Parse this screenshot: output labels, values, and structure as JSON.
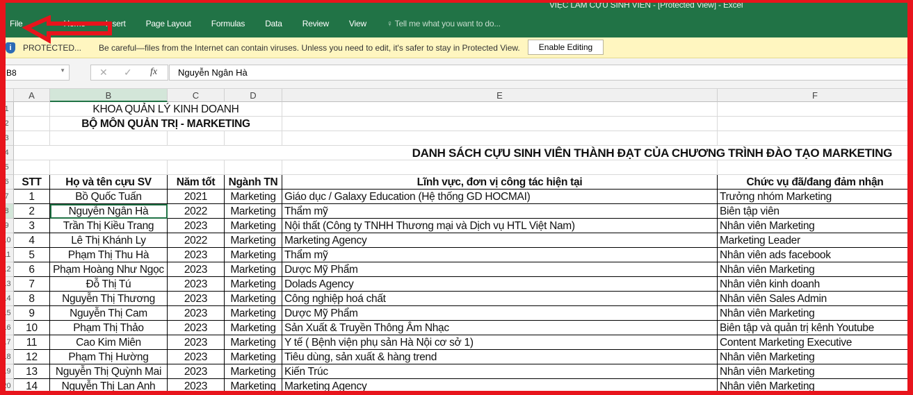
{
  "window": {
    "title": "VIỆC LÀM CỰU SINH VIÊN - [Protected View] - Excel"
  },
  "ribbon": {
    "tabs": [
      "File",
      "Home",
      "Insert",
      "Page Layout",
      "Formulas",
      "Data",
      "Review",
      "View"
    ],
    "tell_me": "Tell me what you want to do..."
  },
  "protected": {
    "label": "PROTECTED...",
    "message": "Be careful—files from the Internet can contain viruses. Unless you need to edit, it's safer to stay in Protected View.",
    "button": "Enable Editing"
  },
  "formula_bar": {
    "name_box": "B8",
    "fx": "fx",
    "value": "Nguyễn Ngân Hà"
  },
  "columns": [
    "A",
    "B",
    "C",
    "D",
    "E",
    "F"
  ],
  "sheet": {
    "line1": "KHOA QUẢN LÝ KINH DOANH",
    "line2": "BỘ MÔN QUẢN TRỊ - MARKETING",
    "title": "DANH SÁCH CỰU SINH VIÊN THÀNH ĐẠT CỦA CHƯƠNG TRÌNH ĐÀO TẠO MARKETING",
    "headers": [
      "STT",
      "Họ và tên cựu SV",
      "Năm tốt",
      "Ngành TN",
      "Lĩnh vực, đơn vị công tác hiện tại",
      "Chức vụ đã/đang đảm nhận"
    ],
    "rows": [
      [
        "1",
        "Bồ Quốc Tuấn",
        "2021",
        "Marketing",
        "Giáo dục / Galaxy Education (Hệ thống GD HOCMAI)",
        "Trưởng nhóm Marketing"
      ],
      [
        "2",
        "Nguyễn Ngân Hà",
        "2022",
        "Marketing",
        "Thẩm mỹ",
        "Biên tập viên"
      ],
      [
        "3",
        "Trần Thị Kiều Trang",
        "2023",
        "Marketing",
        "Nội thất (Công ty TNHH Thương mại và Dịch vụ HTL Việt Nam)",
        "Nhân viên Marketing"
      ],
      [
        "4",
        "Lê Thị Khánh Ly",
        "2022",
        "Marketing",
        "Marketing Agency",
        "Marketing Leader"
      ],
      [
        "5",
        "Phạm Thị Thu Hà",
        "2023",
        "Marketing",
        "Thẩm mỹ",
        "Nhân viên ads facebook"
      ],
      [
        "6",
        "Phạm Hoàng Như Ngọc",
        "2023",
        "Marketing",
        "Dược Mỹ Phẩm",
        "Nhân viên Marketing"
      ],
      [
        "7",
        "Đỗ Thị Tú",
        "2023",
        "Marketing",
        "Dolads Agency",
        "Nhân viên kinh doanh"
      ],
      [
        "8",
        "Nguyễn Thị Thương",
        "2023",
        "Marketing",
        "Công nghiệp hoá chất",
        "Nhân viên Sales Admin"
      ],
      [
        "9",
        "Nguyễn Thị Cam",
        "2023",
        "Marketing",
        "Dược Mỹ Phẩm",
        "Nhân viên Marketing"
      ],
      [
        "10",
        "Phạm Thị Thảo",
        "2023",
        "Marketing",
        "Sản Xuất & Truyền Thông Âm Nhạc",
        "Biên tập và quản trị kênh Youtube"
      ],
      [
        "11",
        "Cao Kim Miên",
        "2023",
        "Marketing",
        "Y tế ( Bệnh viện phụ sản Hà Nội cơ sở 1)",
        "Content Marketing Executive"
      ],
      [
        "12",
        "Phạm Thị Hường",
        "2023",
        "Marketing",
        "Tiêu dùng, sản xuất & hàng trend",
        "Nhân viên Marketing"
      ],
      [
        "13",
        "Nguyễn Thị Quỳnh Mai",
        "2023",
        "Marketing",
        "Kiến Trúc",
        "Nhân viên Marketing"
      ],
      [
        "14",
        "Nguyễn Thị Lan Anh",
        "2023",
        "Marketing",
        "Marketing Agency",
        "Nhân viên Marketing"
      ]
    ]
  },
  "colors": {
    "ribbon": "#217346",
    "annotation": "#e8141c",
    "protected_bar": "#fff6c0"
  }
}
